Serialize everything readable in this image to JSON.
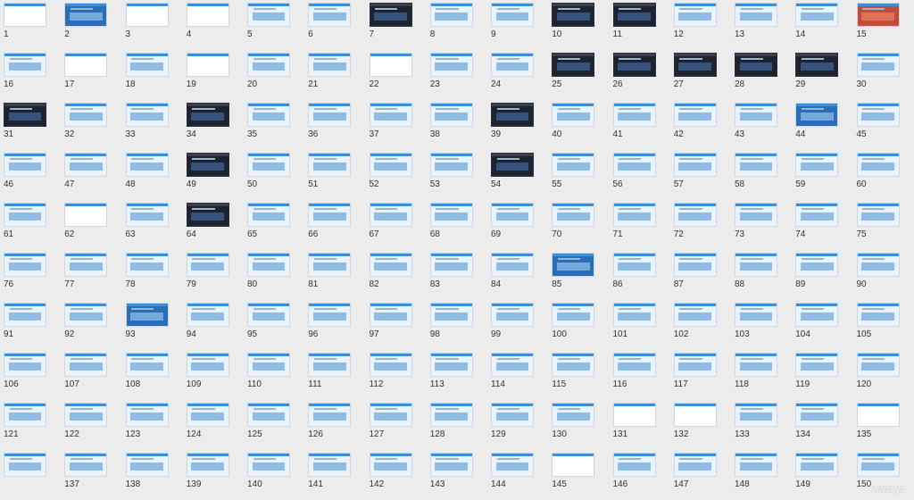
{
  "slides": [
    {
      "n": "1",
      "style": "white"
    },
    {
      "n": "2",
      "style": "blue"
    },
    {
      "n": "3",
      "style": "white"
    },
    {
      "n": "4",
      "style": "white"
    },
    {
      "n": "5",
      "style": "light"
    },
    {
      "n": "6",
      "style": "light"
    },
    {
      "n": "7",
      "style": "dark"
    },
    {
      "n": "8",
      "style": "light"
    },
    {
      "n": "9",
      "style": "light"
    },
    {
      "n": "10",
      "style": "dark"
    },
    {
      "n": "11",
      "style": "dark"
    },
    {
      "n": "12",
      "style": "light"
    },
    {
      "n": "13",
      "style": "light"
    },
    {
      "n": "14",
      "style": "light"
    },
    {
      "n": "15",
      "style": "red"
    },
    {
      "n": "16",
      "style": "light"
    },
    {
      "n": "17",
      "style": "white"
    },
    {
      "n": "18",
      "style": "light"
    },
    {
      "n": "19",
      "style": "white"
    },
    {
      "n": "20",
      "style": "light"
    },
    {
      "n": "21",
      "style": "light"
    },
    {
      "n": "22",
      "style": "white"
    },
    {
      "n": "23",
      "style": "light"
    },
    {
      "n": "24",
      "style": "light"
    },
    {
      "n": "25",
      "style": "dark"
    },
    {
      "n": "26",
      "style": "dark"
    },
    {
      "n": "27",
      "style": "dark"
    },
    {
      "n": "28",
      "style": "dark"
    },
    {
      "n": "29",
      "style": "dark"
    },
    {
      "n": "30",
      "style": "light"
    },
    {
      "n": "31",
      "style": "dark"
    },
    {
      "n": "32",
      "style": "light"
    },
    {
      "n": "33",
      "style": "light"
    },
    {
      "n": "34",
      "style": "dark"
    },
    {
      "n": "35",
      "style": "light"
    },
    {
      "n": "36",
      "style": "light"
    },
    {
      "n": "37",
      "style": "light"
    },
    {
      "n": "38",
      "style": "light"
    },
    {
      "n": "39",
      "style": "dark"
    },
    {
      "n": "40",
      "style": "light"
    },
    {
      "n": "41",
      "style": "light"
    },
    {
      "n": "42",
      "style": "light"
    },
    {
      "n": "43",
      "style": "light"
    },
    {
      "n": "44",
      "style": "blue"
    },
    {
      "n": "45",
      "style": "light"
    },
    {
      "n": "46",
      "style": "light"
    },
    {
      "n": "47",
      "style": "light"
    },
    {
      "n": "48",
      "style": "light"
    },
    {
      "n": "49",
      "style": "dark"
    },
    {
      "n": "50",
      "style": "light"
    },
    {
      "n": "51",
      "style": "light"
    },
    {
      "n": "52",
      "style": "light"
    },
    {
      "n": "53",
      "style": "light"
    },
    {
      "n": "54",
      "style": "dark"
    },
    {
      "n": "55",
      "style": "light"
    },
    {
      "n": "56",
      "style": "light"
    },
    {
      "n": "57",
      "style": "light"
    },
    {
      "n": "58",
      "style": "light"
    },
    {
      "n": "59",
      "style": "light"
    },
    {
      "n": "60",
      "style": "light"
    },
    {
      "n": "61",
      "style": "light"
    },
    {
      "n": "62",
      "style": "white"
    },
    {
      "n": "63",
      "style": "light"
    },
    {
      "n": "64",
      "style": "dark"
    },
    {
      "n": "65",
      "style": "light"
    },
    {
      "n": "66",
      "style": "light"
    },
    {
      "n": "67",
      "style": "light"
    },
    {
      "n": "68",
      "style": "light"
    },
    {
      "n": "69",
      "style": "light"
    },
    {
      "n": "70",
      "style": "light"
    },
    {
      "n": "71",
      "style": "light"
    },
    {
      "n": "72",
      "style": "light"
    },
    {
      "n": "73",
      "style": "light"
    },
    {
      "n": "74",
      "style": "light"
    },
    {
      "n": "75",
      "style": "light"
    },
    {
      "n": "76",
      "style": "light"
    },
    {
      "n": "77",
      "style": "light"
    },
    {
      "n": "78",
      "style": "light"
    },
    {
      "n": "79",
      "style": "light"
    },
    {
      "n": "80",
      "style": "light"
    },
    {
      "n": "81",
      "style": "light"
    },
    {
      "n": "82",
      "style": "light"
    },
    {
      "n": "83",
      "style": "light"
    },
    {
      "n": "84",
      "style": "light"
    },
    {
      "n": "85",
      "style": "blue"
    },
    {
      "n": "86",
      "style": "light"
    },
    {
      "n": "87",
      "style": "light"
    },
    {
      "n": "88",
      "style": "light"
    },
    {
      "n": "89",
      "style": "light"
    },
    {
      "n": "90",
      "style": "light"
    },
    {
      "n": "91",
      "style": "light"
    },
    {
      "n": "92",
      "style": "light"
    },
    {
      "n": "93",
      "style": "blue"
    },
    {
      "n": "94",
      "style": "light"
    },
    {
      "n": "95",
      "style": "light"
    },
    {
      "n": "96",
      "style": "light"
    },
    {
      "n": "97",
      "style": "light"
    },
    {
      "n": "98",
      "style": "light"
    },
    {
      "n": "99",
      "style": "light"
    },
    {
      "n": "100",
      "style": "light"
    },
    {
      "n": "101",
      "style": "light"
    },
    {
      "n": "102",
      "style": "light"
    },
    {
      "n": "103",
      "style": "light"
    },
    {
      "n": "104",
      "style": "light"
    },
    {
      "n": "105",
      "style": "light"
    },
    {
      "n": "106",
      "style": "light"
    },
    {
      "n": "107",
      "style": "light"
    },
    {
      "n": "108",
      "style": "light"
    },
    {
      "n": "109",
      "style": "light"
    },
    {
      "n": "110",
      "style": "light"
    },
    {
      "n": "111",
      "style": "light"
    },
    {
      "n": "112",
      "style": "light"
    },
    {
      "n": "113",
      "style": "light"
    },
    {
      "n": "114",
      "style": "light"
    },
    {
      "n": "115",
      "style": "light"
    },
    {
      "n": "116",
      "style": "light"
    },
    {
      "n": "117",
      "style": "light"
    },
    {
      "n": "118",
      "style": "light"
    },
    {
      "n": "119",
      "style": "light"
    },
    {
      "n": "120",
      "style": "light"
    },
    {
      "n": "121",
      "style": "light"
    },
    {
      "n": "122",
      "style": "light"
    },
    {
      "n": "123",
      "style": "light"
    },
    {
      "n": "124",
      "style": "light"
    },
    {
      "n": "125",
      "style": "light"
    },
    {
      "n": "126",
      "style": "light"
    },
    {
      "n": "127",
      "style": "light"
    },
    {
      "n": "128",
      "style": "light"
    },
    {
      "n": "129",
      "style": "light"
    },
    {
      "n": "130",
      "style": "light"
    },
    {
      "n": "131",
      "style": "white"
    },
    {
      "n": "132",
      "style": "white"
    },
    {
      "n": "133",
      "style": "light"
    },
    {
      "n": "134",
      "style": "light"
    },
    {
      "n": "135",
      "style": "white"
    },
    {
      "n": "",
      "style": "light"
    },
    {
      "n": "137",
      "style": "light"
    },
    {
      "n": "138",
      "style": "light"
    },
    {
      "n": "139",
      "style": "light"
    },
    {
      "n": "140",
      "style": "light"
    },
    {
      "n": "141",
      "style": "light"
    },
    {
      "n": "142",
      "style": "light"
    },
    {
      "n": "143",
      "style": "light"
    },
    {
      "n": "144",
      "style": "light"
    },
    {
      "n": "145",
      "style": "white"
    },
    {
      "n": "146",
      "style": "light"
    },
    {
      "n": "147",
      "style": "light"
    },
    {
      "n": "148",
      "style": "light"
    },
    {
      "n": "149",
      "style": "light"
    },
    {
      "n": "150",
      "style": "light"
    }
  ],
  "watermark": "www.yc",
  "colors": {
    "white": "#ffffff",
    "light": "#eaf3fb",
    "dark": "#1e2330",
    "blue": "#2a6fb5",
    "red": "#c54a3c",
    "accent_bar": "#3c8ed6",
    "accent_blk": "#7fb3e0"
  }
}
